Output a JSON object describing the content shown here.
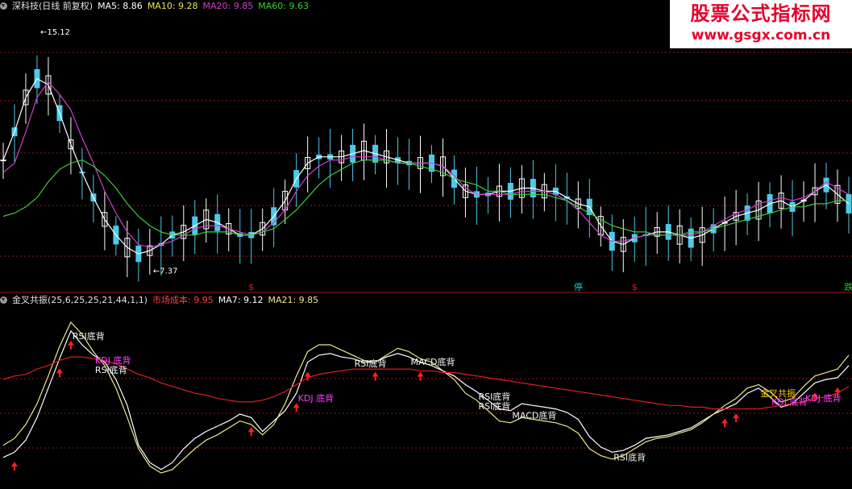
{
  "upper_header": {
    "title": "深科技(日线 前复权)",
    "ma5": "MA5: 8.86",
    "ma10": "MA10: 9.28",
    "ma20": "MA20: 9.85",
    "ma60": "MA60: 9.63"
  },
  "lower_header": {
    "title": "金叉共振(25,6,25,25,21,44,1,1)",
    "cost": "市场成本: 9.95",
    "ma7": "MA7: 9.12",
    "ma21": "MA21: 9.85"
  },
  "watermark": {
    "title": "股票公式指标网",
    "url": "www.gsgx.com.cn"
  },
  "colors": {
    "background": "#000000",
    "up_candle": "#ffffff",
    "ma5": "#ffffff",
    "ma10": "#e8e84c",
    "ma20": "#d23cd2",
    "ma60": "#3ccc3c",
    "cost_line": "#dd1f1f",
    "fast_line": "#ffffff",
    "slow_line": "#f0e68c",
    "arrow": "#ff2020",
    "grid": "#8b1a1a"
  },
  "chart_data": [
    {
      "type": "candlestick",
      "title": "深科技(日线 前复权)",
      "ylim": [
        7.0,
        15.5
      ],
      "high_label": "15.12",
      "low_label": "7.37",
      "series": [
        {
          "name": "MA5",
          "values": [
            10.9,
            11.8,
            12.9,
            13.5,
            13.3,
            12.4,
            11.4,
            10.5,
            9.7,
            9.0,
            8.5,
            8.1,
            7.9,
            8.0,
            8.2,
            8.5,
            8.6,
            8.8,
            9.0,
            8.9,
            8.7,
            8.5,
            8.5,
            8.7,
            9.1,
            9.6,
            10.3,
            10.8,
            11.0,
            11.0,
            11.0,
            11.1,
            11.2,
            11.1,
            11.0,
            10.9,
            10.8,
            10.8,
            10.8,
            10.7,
            10.3,
            9.9,
            9.8,
            9.8,
            9.9,
            9.9,
            10.0,
            10.0,
            9.9,
            9.9,
            9.7,
            9.5,
            9.4,
            8.8,
            8.3,
            8.2,
            8.4,
            8.5,
            8.6,
            8.6,
            8.5,
            8.4,
            8.5,
            8.7,
            8.9,
            9.1,
            9.2,
            9.3,
            9.5,
            9.6,
            9.4,
            9.6,
            9.9,
            10.1,
            9.8,
            9.5
          ]
        },
        {
          "name": "MA20",
          "values": [
            10.5,
            10.8,
            11.8,
            12.9,
            13.4,
            13.0,
            12.5,
            11.6,
            10.8,
            9.9,
            9.2,
            8.6,
            8.2,
            8.1,
            8.2,
            8.3,
            8.5,
            8.7,
            8.8,
            8.8,
            8.7,
            8.6,
            8.5,
            8.6,
            8.9,
            9.3,
            9.9,
            10.4,
            10.7,
            10.9,
            10.9,
            11.0,
            11.0,
            11.0,
            10.9,
            10.8,
            10.8,
            10.8,
            10.8,
            10.7,
            10.4,
            10.0,
            9.8,
            9.8,
            9.8,
            9.8,
            9.9,
            9.9,
            9.9,
            9.8,
            9.6,
            9.3,
            8.9,
            8.5,
            8.3,
            8.3,
            8.4,
            8.5,
            8.5,
            8.5,
            8.5,
            8.5,
            8.6,
            8.8,
            9.0,
            9.2,
            9.3,
            9.5,
            9.6,
            9.7,
            9.6,
            9.7,
            9.9,
            10.2,
            10.0,
            9.8
          ]
        },
        {
          "name": "MA60",
          "values": [
            9.1,
            9.2,
            9.4,
            9.7,
            10.2,
            10.6,
            10.8,
            10.9,
            10.7,
            10.4,
            10.0,
            9.5,
            9.1,
            8.8,
            8.6,
            8.5,
            8.5,
            8.5,
            8.6,
            8.6,
            8.6,
            8.5,
            8.5,
            8.6,
            8.7,
            9.0,
            9.3,
            9.7,
            10.1,
            10.4,
            10.6,
            10.8,
            10.9,
            10.9,
            10.9,
            10.8,
            10.8,
            10.7,
            10.6,
            10.5,
            10.3,
            10.2,
            10.1,
            9.9,
            9.9,
            9.8,
            9.8,
            9.8,
            9.8,
            9.7,
            9.6,
            9.4,
            9.2,
            9.0,
            8.8,
            8.7,
            8.6,
            8.6,
            8.5,
            8.5,
            8.5,
            8.6,
            8.6,
            8.7,
            8.8,
            8.9,
            9.0,
            9.1,
            9.2,
            9.3,
            9.4,
            9.4,
            9.5,
            9.5,
            9.6,
            9.6
          ]
        }
      ],
      "markers": [
        {
          "x": 22,
          "label": "$",
          "color": "#dd2020"
        },
        {
          "x": 51,
          "label": "停",
          "color": "#22c8c8"
        },
        {
          "x": 56,
          "label": "$",
          "color": "#dd2020"
        },
        {
          "x": 75,
          "label": "跌",
          "color": "#22cc22"
        }
      ]
    },
    {
      "type": "line",
      "title": "金叉共振(25,6,25,25,21,44,1,1)",
      "ylim": [
        0,
        100
      ],
      "series": [
        {
          "name": "MA7",
          "values": [
            15,
            18,
            25,
            38,
            55,
            72,
            88,
            80,
            74,
            70,
            60,
            45,
            22,
            12,
            8,
            12,
            20,
            26,
            30,
            33,
            36,
            40,
            38,
            30,
            36,
            42,
            52,
            70,
            74,
            75,
            73,
            72,
            70,
            70,
            73,
            75,
            73,
            70,
            68,
            65,
            62,
            57,
            53,
            48,
            43,
            42,
            46,
            45,
            44,
            43,
            41,
            37,
            27,
            21,
            18,
            19,
            22,
            26,
            27,
            28,
            30,
            32,
            36,
            40,
            43,
            46,
            52,
            55,
            50,
            44,
            46,
            52,
            58,
            60,
            61,
            68
          ]
        },
        {
          "name": "MA21",
          "values": [
            22,
            26,
            34,
            46,
            62,
            79,
            93,
            86,
            76,
            68,
            55,
            38,
            20,
            10,
            6,
            8,
            14,
            20,
            25,
            28,
            32,
            36,
            34,
            28,
            34,
            46,
            62,
            76,
            80,
            80,
            77,
            74,
            71,
            70,
            74,
            78,
            76,
            72,
            70,
            65,
            60,
            52,
            48,
            42,
            36,
            35,
            38,
            37,
            36,
            35,
            33,
            29,
            20,
            16,
            14,
            16,
            20,
            24,
            26,
            27,
            29,
            31,
            35,
            40,
            45,
            49,
            55,
            57,
            53,
            47,
            49,
            56,
            62,
            64,
            66,
            74
          ]
        },
        {
          "name": "市场成本",
          "values": [
            60,
            62,
            63,
            66,
            68,
            71,
            73,
            73,
            72,
            71,
            69,
            66,
            63,
            61,
            58,
            56,
            54,
            52,
            51,
            49,
            48,
            47,
            47,
            48,
            50,
            53,
            57,
            61,
            63,
            64,
            65,
            66,
            66,
            66,
            66,
            66,
            66,
            65,
            65,
            64,
            64,
            63,
            62,
            61,
            60,
            59,
            58,
            57,
            56,
            55,
            54,
            53,
            52,
            51,
            50,
            49,
            48,
            47,
            46,
            45,
            45,
            44,
            44,
            43,
            43,
            43,
            43,
            43,
            44,
            45,
            46,
            47,
            49,
            50,
            52,
            56
          ]
        }
      ],
      "annotations": [
        {
          "x": 6,
          "label": "RSI底背"
        },
        {
          "x": 8,
          "label": "KDJ 底背"
        },
        {
          "x": 8,
          "label": "RSI底背"
        },
        {
          "x": 26,
          "label": "KDJ 底背"
        },
        {
          "x": 31,
          "label": "RSI底背"
        },
        {
          "x": 36,
          "label": "MACD底背"
        },
        {
          "x": 42,
          "label": "RSI底背"
        },
        {
          "x": 42,
          "label": "RSI底背"
        },
        {
          "x": 45,
          "label": "MACD底背"
        },
        {
          "x": 54,
          "label": "RSI底背"
        },
        {
          "x": 67,
          "label": "金叉共振"
        },
        {
          "x": 68,
          "label": "KDJ 底背"
        },
        {
          "x": 71,
          "label": "KDJ 底背"
        }
      ],
      "arrows_x": [
        1,
        5,
        6,
        22,
        26,
        27,
        33,
        37,
        64,
        65,
        72,
        74
      ]
    }
  ]
}
